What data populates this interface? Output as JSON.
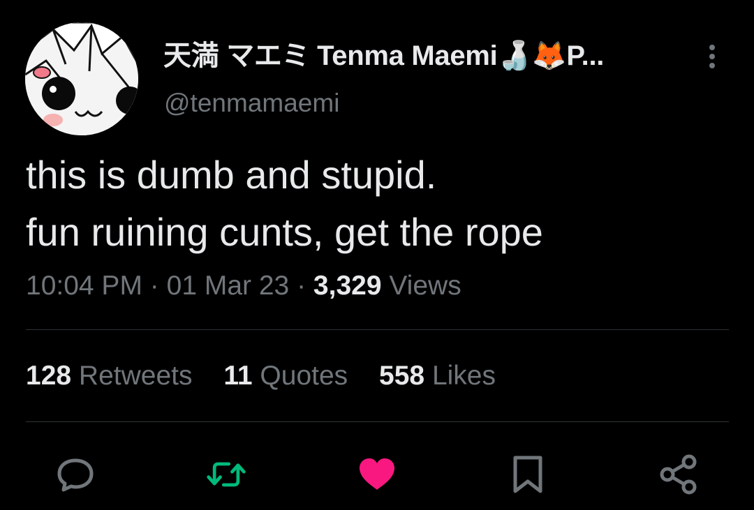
{
  "author": {
    "display_name": "天満 マエミ Tenma Maemi",
    "display_name_emoji": "🍶🦊",
    "display_name_truncated": "P...",
    "handle": "@tenmamaemi",
    "avatar_icon": "anime-avatar-icon"
  },
  "tweet": {
    "lines": [
      "this is dumb and stupid.",
      "fun ruining cunts, get the rope"
    ],
    "time": "10:04 PM",
    "date": "01 Mar 23",
    "separator": "·",
    "views_count": "3,329",
    "views_label": "Views"
  },
  "stats": {
    "retweets_count": "128",
    "retweets_label": "Retweets",
    "quotes_count": "11",
    "quotes_label": "Quotes",
    "likes_count": "558",
    "likes_label": "Likes"
  },
  "actions": [
    {
      "name": "reply",
      "icon": "reply-icon",
      "color": "#71767b"
    },
    {
      "name": "retweet",
      "icon": "retweet-icon",
      "color": "#00ba7c"
    },
    {
      "name": "like",
      "icon": "heart-icon",
      "color": "#f91880"
    },
    {
      "name": "bookmark",
      "icon": "bookmark-icon",
      "color": "#71767b"
    },
    {
      "name": "share",
      "icon": "share-icon",
      "color": "#71767b"
    }
  ],
  "colors": {
    "background": "#000000",
    "text_primary": "#e7e9ea",
    "text_secondary": "#71767b",
    "divider": "#2f3336",
    "retweet_active": "#00ba7c",
    "like_active": "#f91880"
  }
}
